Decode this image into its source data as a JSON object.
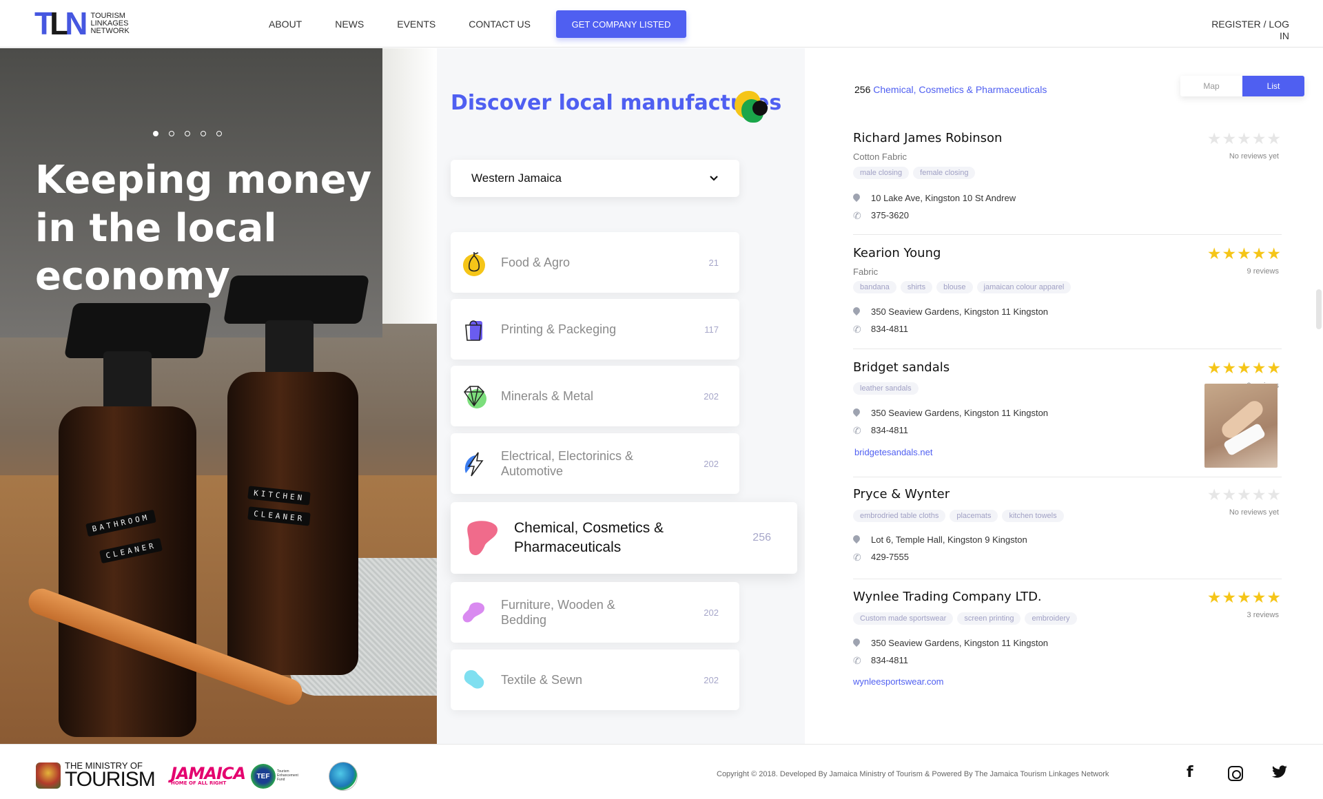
{
  "header": {
    "logo_mark": "TLN",
    "logo_text": "TOURISM LINKAGES NETWORK",
    "nav": [
      "ABOUT",
      "NEWS",
      "EVENTS",
      "CONTACT US"
    ],
    "cta": "GET COMPANY LISTED",
    "register": "REGISTER / LOG IN"
  },
  "hero": {
    "title": "Keeping money in the local economy",
    "carousel_dots": 5,
    "active_dot": 1,
    "label_left_1": "BATHROOM",
    "label_left_2": "CLEANER",
    "label_right_1": "KITCHEN",
    "label_right_2": "CLEANER"
  },
  "discover": {
    "title": "Discover local manufactures",
    "region": "Western Jamaica",
    "categories": [
      {
        "name": "Food & Agro",
        "count": "21",
        "icon": "pear-icon"
      },
      {
        "name": "Printing & Packeging",
        "count": "117",
        "icon": "shopping-bag-icon"
      },
      {
        "name": "Minerals & Metal",
        "count": "202",
        "icon": "diamond-icon"
      },
      {
        "name": "Electrical, Electorinics & Automotive",
        "count": "202",
        "icon": "lightning-icon"
      },
      {
        "name": "Chemical, Cosmetics & Pharmaceuticals",
        "count": "256",
        "icon": "blob-icon"
      },
      {
        "name": "Furniture, Wooden & Bedding",
        "count": "202",
        "icon": "blob-icon"
      },
      {
        "name": "Textile & Sewn",
        "count": "202",
        "icon": "blob-icon"
      }
    ]
  },
  "results": {
    "count": "256",
    "category": "Chemical, Cosmetics & Pharmaceuticals",
    "view_map": "Map",
    "view_list": "List",
    "items": [
      {
        "name": "Richard James Robinson",
        "type": "Cotton Fabric",
        "tags": [
          "male closing",
          "female closing"
        ],
        "address": "10 Lake Ave, Kingston 10 St Andrew",
        "phone": "375-3620",
        "rating": 0,
        "reviews": "No reviews yet"
      },
      {
        "name": "Kearion Young",
        "type": "Fabric",
        "tags": [
          "bandana",
          "shirts",
          "blouse",
          "jamaican colour apparel"
        ],
        "address": "350 Seaview Gardens, Kingston 11 Kingston",
        "phone": "834-4811",
        "rating": 5,
        "reviews": "9 reviews"
      },
      {
        "name": "Bridget sandals",
        "type": "",
        "tags": [
          "leather sandals"
        ],
        "address": "350 Seaview Gardens, Kingston 11 Kingston",
        "phone": "834-4811",
        "website": "bridgetesandals.net",
        "rating": 5,
        "reviews": "9 reviews"
      },
      {
        "name": "Pryce & Wynter",
        "type": "",
        "tags": [
          "embrodried table cloths",
          "placemats",
          "kitchen towels"
        ],
        "address": "Lot 6, Temple Hall, Kingston 9 Kingston",
        "phone": "429-7555",
        "rating": 0,
        "reviews": "No reviews yet"
      },
      {
        "name": "Wynlee Trading Company LTD.",
        "type": "",
        "tags": [
          "Custom made sportswear",
          "screen printing",
          "embroidery"
        ],
        "address": "350 Seaview Gardens, Kingston 11 Kingston",
        "phone": "834-4811",
        "website": "wynleesportswear.com",
        "rating": 5,
        "reviews": "3 reviews"
      }
    ]
  },
  "footer": {
    "mot_small": "THE MINISTRY OF",
    "mot_big": "TOURISM",
    "jamaica": "JAMAICA",
    "jamaica_tag": "HOME OF ALL RIGHT",
    "tef": "TEF",
    "tef_sub": "Tourism Enhancement Fund",
    "copyright": "Copyright © 2018. Developed By Jamaica Ministry of Tourism & Powered By The Jamaica Tourism Linkages Network",
    "social": [
      "facebook-icon",
      "instagram-icon",
      "twitter-icon"
    ]
  },
  "colors": {
    "accent": "#4f5ff1",
    "star": "#f5c518",
    "jamaica_pink": "#e4006e"
  }
}
